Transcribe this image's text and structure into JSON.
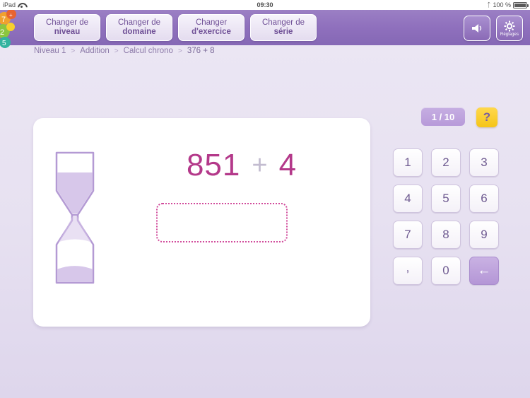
{
  "statusbar": {
    "device": "iPad",
    "wifi_icon": "wifi-icon",
    "time": "09:30",
    "bluetooth_icon": "bluetooth-icon",
    "battery_percent": "100 %",
    "battery_icon": "battery-full-icon"
  },
  "header": {
    "logo_icon": "app-logo-icon",
    "buttons": [
      {
        "line1": "Changer de",
        "line2": "niveau",
        "name": "change-level-button"
      },
      {
        "line1": "Changer de",
        "line2": "domaine",
        "name": "change-domain-button"
      },
      {
        "line1": "Changer",
        "line2": "d'exercice",
        "name": "change-exercise-button"
      },
      {
        "line1": "Changer de",
        "line2": "série",
        "name": "change-series-button"
      }
    ],
    "sound_button": {
      "icon": "speaker-icon",
      "label": ""
    },
    "settings_button": {
      "icon": "gear-icon",
      "label": "Réglages"
    }
  },
  "breadcrumb": {
    "separator": ">",
    "items": [
      "Niveau 1",
      "Addition",
      "Calcul chrono",
      "376 + 8"
    ]
  },
  "progress": {
    "counter": "1 / 10",
    "help_label": "?",
    "help_icon": "question-mark-icon"
  },
  "exercise": {
    "timer_icon": "hourglass-icon",
    "operand_left": "851",
    "operator": "+",
    "operand_right": "4",
    "answer_value": "",
    "answer_placeholder": ""
  },
  "keypad": {
    "keys": [
      {
        "label": "1",
        "name": "key-1"
      },
      {
        "label": "2",
        "name": "key-2"
      },
      {
        "label": "3",
        "name": "key-3"
      },
      {
        "label": "4",
        "name": "key-4"
      },
      {
        "label": "5",
        "name": "key-5"
      },
      {
        "label": "6",
        "name": "key-6"
      },
      {
        "label": "7",
        "name": "key-7"
      },
      {
        "label": "8",
        "name": "key-8"
      },
      {
        "label": "9",
        "name": "key-9"
      },
      {
        "label": ",",
        "name": "key-comma"
      },
      {
        "label": "0",
        "name": "key-0"
      },
      {
        "label": "←",
        "name": "key-backspace"
      }
    ]
  },
  "colors": {
    "header_purple": "#8f70bd",
    "background": "#e9e4f2",
    "accent_pink": "#b4398a",
    "answer_border": "#d14b9b",
    "counter_purple": "#b79ad9",
    "help_yellow": "#f5c518",
    "key_text": "#6f5b91"
  }
}
